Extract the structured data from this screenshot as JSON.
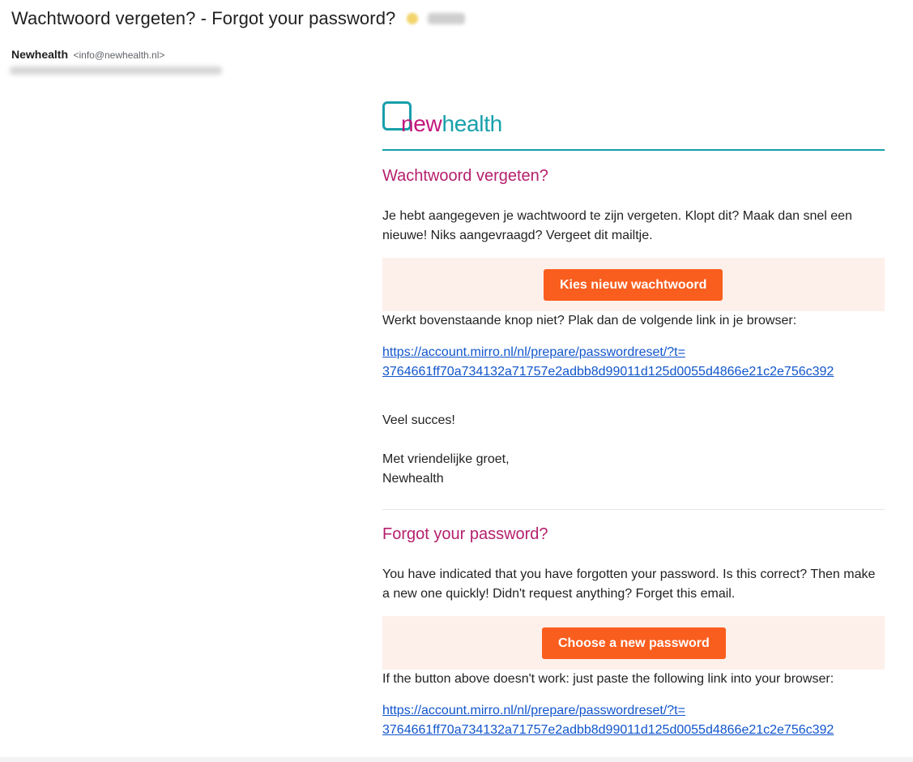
{
  "header": {
    "subject": "Wachtwoord vergeten? - Forgot your password?",
    "sender_name": "Newhealth",
    "sender_email": "<info@newhealth.nl>"
  },
  "logo": {
    "part1": "new",
    "part2": "health"
  },
  "dutch": {
    "heading": "Wachtwoord vergeten?",
    "intro": "Je hebt aangegeven je wachtwoord te zijn vergeten. Klopt dit? Maak dan snel een nieuwe! Niks aangevraagd? Vergeet dit mailtje.",
    "button_label": "Kies nieuw wachtwoord",
    "fallback_text": "Werkt bovenstaande knop niet? Plak dan de volgende link in je browser:",
    "link_line1": "https://account.mirro.nl/nl/prepare/passwordreset/?t=",
    "link_line2": "3764661ff70a734132a71757e2adbb8d99011d125d0055d4866e21c2e756c392",
    "closing": "Veel succes!",
    "signoff": "Met vriendelijke groet,",
    "signature": "Newhealth"
  },
  "english": {
    "heading": "Forgot your password?",
    "intro": "You have indicated that you have forgotten your password. Is this correct? Then make a new one quickly! Didn't request anything? Forget this email.",
    "button_label": "Choose a new password",
    "fallback_text": "If the button above doesn't work: just paste the following link into your browser:",
    "link_line1": "https://account.mirro.nl/nl/prepare/passwordreset/?t=",
    "link_line2": "3764661ff70a734132a71757e2adbb8d99011d125d0055d4866e21c2e756c392"
  },
  "colors": {
    "brand_magenta": "#c2177b",
    "brand_teal": "#17a0ab",
    "heading": "#b5206d",
    "button": "#fa5e1f",
    "button_band": "#fdf0ea",
    "link": "#1155cc"
  },
  "icons": {
    "star": "star-icon",
    "logo_mark": "logo-mark-icon"
  }
}
